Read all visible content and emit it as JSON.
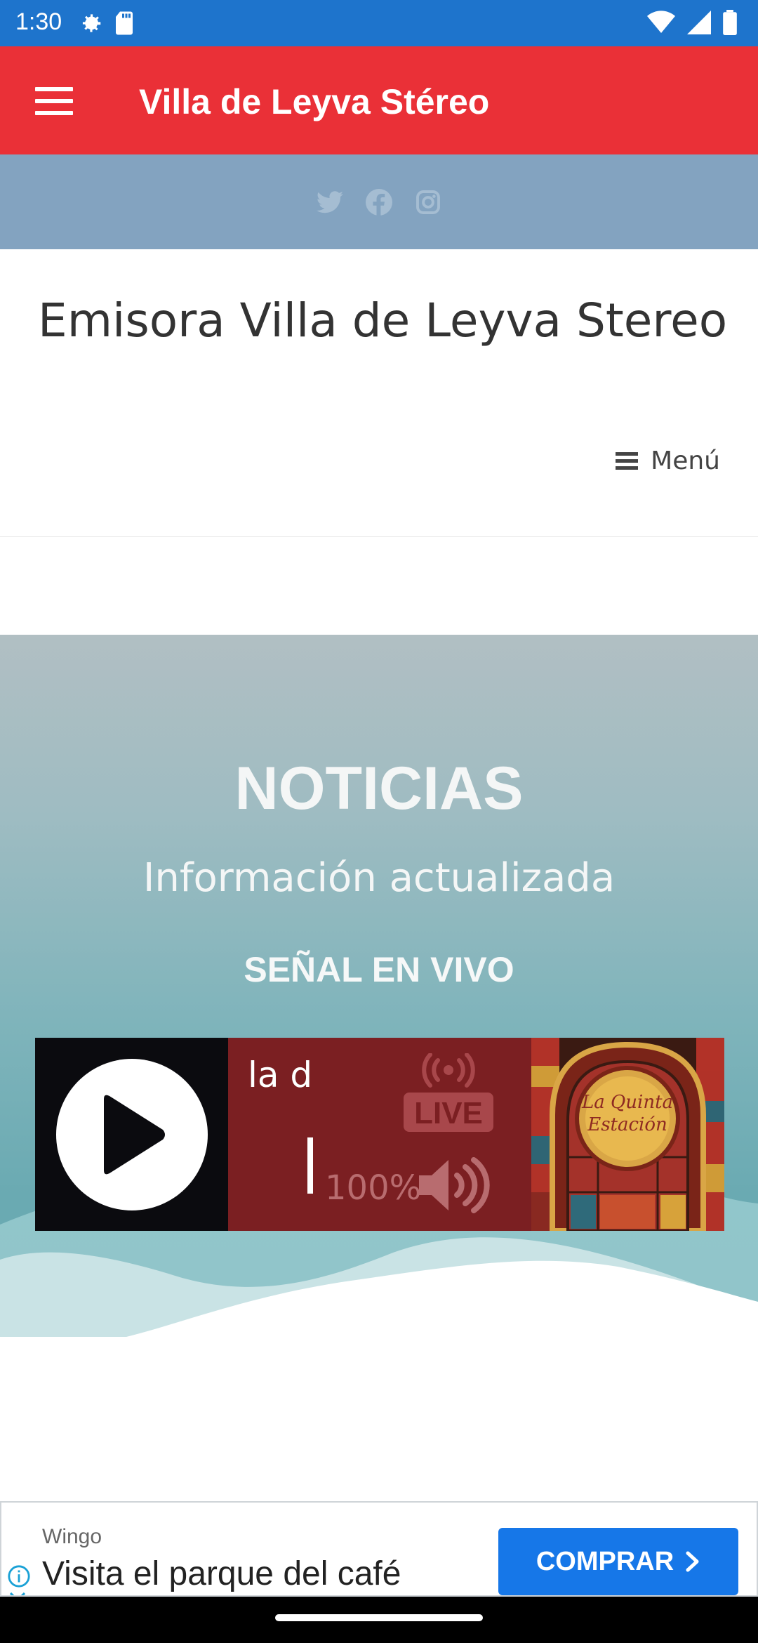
{
  "status_bar": {
    "time": "1:30",
    "icons_left": [
      "settings-icon",
      "sd-card-icon"
    ],
    "icons_right": [
      "wifi-icon",
      "signal-icon",
      "battery-icon"
    ]
  },
  "app_bar": {
    "title": "Villa de Leyva Stéreo",
    "color": "#ea3037"
  },
  "social": {
    "icons": [
      "twitter-icon",
      "facebook-icon",
      "instagram-icon"
    ],
    "icon_color": "#a5bdd2"
  },
  "site": {
    "title": "Emisora Villa de Leyva Stereo",
    "menu_label": "Menú"
  },
  "hero": {
    "heading": "NOTICIAS",
    "subheading": "Información actualizada",
    "live_label": "SEÑAL EN VIVO"
  },
  "player": {
    "now_playing": "la d",
    "volume_percent": "100%",
    "volume_level": 1.0,
    "live_badge": "LIVE",
    "album_art_text": "La Quinta Estación"
  },
  "ad": {
    "advertiser": "Wingo",
    "headline": "Visita el parque del café",
    "cta": "COMPRAR",
    "cta_color": "#1677e8"
  }
}
